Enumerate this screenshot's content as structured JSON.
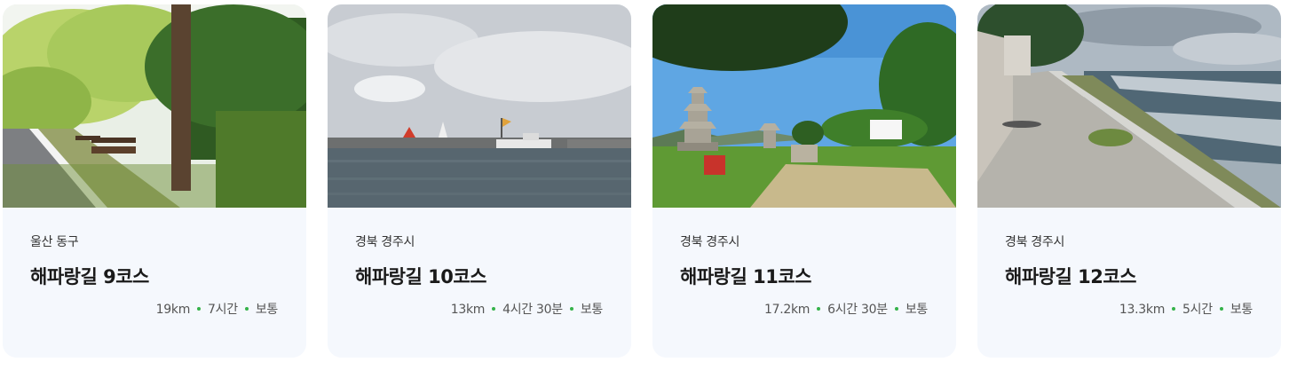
{
  "courses": [
    {
      "region": "울산 동구",
      "title": "해파랑길 9코스",
      "distance": "19km",
      "duration": "7시간",
      "difficulty": "보통",
      "image_desc": "park-path-with-benches"
    },
    {
      "region": "경북 경주시",
      "title": "해파랑길 10코스",
      "distance": "13km",
      "duration": "4시간 30분",
      "difficulty": "보통",
      "image_desc": "harbor-with-boats"
    },
    {
      "region": "경북 경주시",
      "title": "해파랑길 11코스",
      "distance": "17.2km",
      "duration": "6시간 30분",
      "difficulty": "보통",
      "image_desc": "stone-pagodas-on-grass"
    },
    {
      "region": "경북 경주시",
      "title": "해파랑길 12코스",
      "distance": "13.3km",
      "duration": "5시간",
      "difficulty": "보통",
      "image_desc": "coastal-seawall-path"
    }
  ],
  "colors": {
    "card_bg": "#f5f8fd",
    "dot": "#35b24a",
    "title": "#1a1a1a"
  }
}
